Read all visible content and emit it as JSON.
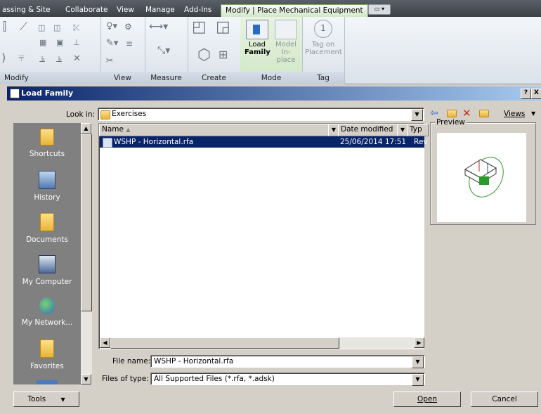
{
  "ribbon": {
    "tabs": [
      "assing & Site",
      "Collaborate",
      "View",
      "Manage",
      "Add-Ins",
      "Modify | Place Mechanical Equipment"
    ],
    "panels": {
      "modify": "Modify",
      "view": "View",
      "measure": "Measure",
      "create": "Create",
      "mode": "Mode",
      "tag": "Tag"
    },
    "load_family": [
      "Load",
      "Family"
    ],
    "model_inplace": [
      "Model",
      "In-place"
    ],
    "tag_on_placement": [
      "Tag on",
      "Placement"
    ]
  },
  "dialog": {
    "title": "Load Family",
    "help": "?",
    "close": "X",
    "look_in_label": "Look in:",
    "look_in_value": "Exercises",
    "views_label": "Views",
    "preview_label": "Preview",
    "places": [
      "Shortcuts",
      "History",
      "Documents",
      "My Computer",
      "My Network...",
      "Favorites"
    ],
    "columns": {
      "name": "Name",
      "date": "Date modified",
      "type": "Typ"
    },
    "files": [
      {
        "name": "WSHP - Horizontal.rfa",
        "date": "25/06/2014 17:51",
        "type": "Rev"
      }
    ],
    "file_name_label": "File name:",
    "file_name_value": "WSHP - Horizontal.rfa",
    "files_of_type_label": "Files of type:",
    "files_of_type_value": "All Supported Files  (*.rfa, *.adsk)",
    "tools_button": "Tools",
    "open_button": "Open",
    "cancel_button": "Cancel"
  }
}
